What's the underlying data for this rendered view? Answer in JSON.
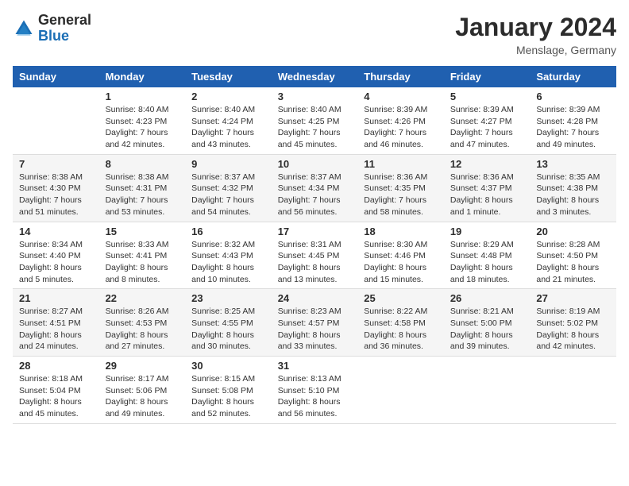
{
  "header": {
    "logo_general": "General",
    "logo_blue": "Blue",
    "month_title": "January 2024",
    "location": "Menslage, Germany"
  },
  "days_of_week": [
    "Sunday",
    "Monday",
    "Tuesday",
    "Wednesday",
    "Thursday",
    "Friday",
    "Saturday"
  ],
  "weeks": [
    [
      {
        "day": "",
        "info": ""
      },
      {
        "day": "1",
        "info": "Sunrise: 8:40 AM\nSunset: 4:23 PM\nDaylight: 7 hours\nand 42 minutes."
      },
      {
        "day": "2",
        "info": "Sunrise: 8:40 AM\nSunset: 4:24 PM\nDaylight: 7 hours\nand 43 minutes."
      },
      {
        "day": "3",
        "info": "Sunrise: 8:40 AM\nSunset: 4:25 PM\nDaylight: 7 hours\nand 45 minutes."
      },
      {
        "day": "4",
        "info": "Sunrise: 8:39 AM\nSunset: 4:26 PM\nDaylight: 7 hours\nand 46 minutes."
      },
      {
        "day": "5",
        "info": "Sunrise: 8:39 AM\nSunset: 4:27 PM\nDaylight: 7 hours\nand 47 minutes."
      },
      {
        "day": "6",
        "info": "Sunrise: 8:39 AM\nSunset: 4:28 PM\nDaylight: 7 hours\nand 49 minutes."
      }
    ],
    [
      {
        "day": "7",
        "info": "Sunrise: 8:38 AM\nSunset: 4:30 PM\nDaylight: 7 hours\nand 51 minutes."
      },
      {
        "day": "8",
        "info": "Sunrise: 8:38 AM\nSunset: 4:31 PM\nDaylight: 7 hours\nand 53 minutes."
      },
      {
        "day": "9",
        "info": "Sunrise: 8:37 AM\nSunset: 4:32 PM\nDaylight: 7 hours\nand 54 minutes."
      },
      {
        "day": "10",
        "info": "Sunrise: 8:37 AM\nSunset: 4:34 PM\nDaylight: 7 hours\nand 56 minutes."
      },
      {
        "day": "11",
        "info": "Sunrise: 8:36 AM\nSunset: 4:35 PM\nDaylight: 7 hours\nand 58 minutes."
      },
      {
        "day": "12",
        "info": "Sunrise: 8:36 AM\nSunset: 4:37 PM\nDaylight: 8 hours\nand 1 minute."
      },
      {
        "day": "13",
        "info": "Sunrise: 8:35 AM\nSunset: 4:38 PM\nDaylight: 8 hours\nand 3 minutes."
      }
    ],
    [
      {
        "day": "14",
        "info": "Sunrise: 8:34 AM\nSunset: 4:40 PM\nDaylight: 8 hours\nand 5 minutes."
      },
      {
        "day": "15",
        "info": "Sunrise: 8:33 AM\nSunset: 4:41 PM\nDaylight: 8 hours\nand 8 minutes."
      },
      {
        "day": "16",
        "info": "Sunrise: 8:32 AM\nSunset: 4:43 PM\nDaylight: 8 hours\nand 10 minutes."
      },
      {
        "day": "17",
        "info": "Sunrise: 8:31 AM\nSunset: 4:45 PM\nDaylight: 8 hours\nand 13 minutes."
      },
      {
        "day": "18",
        "info": "Sunrise: 8:30 AM\nSunset: 4:46 PM\nDaylight: 8 hours\nand 15 minutes."
      },
      {
        "day": "19",
        "info": "Sunrise: 8:29 AM\nSunset: 4:48 PM\nDaylight: 8 hours\nand 18 minutes."
      },
      {
        "day": "20",
        "info": "Sunrise: 8:28 AM\nSunset: 4:50 PM\nDaylight: 8 hours\nand 21 minutes."
      }
    ],
    [
      {
        "day": "21",
        "info": "Sunrise: 8:27 AM\nSunset: 4:51 PM\nDaylight: 8 hours\nand 24 minutes."
      },
      {
        "day": "22",
        "info": "Sunrise: 8:26 AM\nSunset: 4:53 PM\nDaylight: 8 hours\nand 27 minutes."
      },
      {
        "day": "23",
        "info": "Sunrise: 8:25 AM\nSunset: 4:55 PM\nDaylight: 8 hours\nand 30 minutes."
      },
      {
        "day": "24",
        "info": "Sunrise: 8:23 AM\nSunset: 4:57 PM\nDaylight: 8 hours\nand 33 minutes."
      },
      {
        "day": "25",
        "info": "Sunrise: 8:22 AM\nSunset: 4:58 PM\nDaylight: 8 hours\nand 36 minutes."
      },
      {
        "day": "26",
        "info": "Sunrise: 8:21 AM\nSunset: 5:00 PM\nDaylight: 8 hours\nand 39 minutes."
      },
      {
        "day": "27",
        "info": "Sunrise: 8:19 AM\nSunset: 5:02 PM\nDaylight: 8 hours\nand 42 minutes."
      }
    ],
    [
      {
        "day": "28",
        "info": "Sunrise: 8:18 AM\nSunset: 5:04 PM\nDaylight: 8 hours\nand 45 minutes."
      },
      {
        "day": "29",
        "info": "Sunrise: 8:17 AM\nSunset: 5:06 PM\nDaylight: 8 hours\nand 49 minutes."
      },
      {
        "day": "30",
        "info": "Sunrise: 8:15 AM\nSunset: 5:08 PM\nDaylight: 8 hours\nand 52 minutes."
      },
      {
        "day": "31",
        "info": "Sunrise: 8:13 AM\nSunset: 5:10 PM\nDaylight: 8 hours\nand 56 minutes."
      },
      {
        "day": "",
        "info": ""
      },
      {
        "day": "",
        "info": ""
      },
      {
        "day": "",
        "info": ""
      }
    ]
  ]
}
